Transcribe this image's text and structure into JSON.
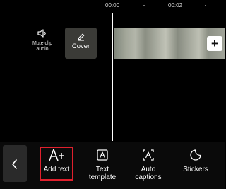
{
  "timeline": {
    "time_labels": [
      "00:00",
      "00:02"
    ]
  },
  "left_controls": {
    "mute_label": "Mute clip\naudio",
    "cover_label": "Cover"
  },
  "clip": {
    "add_clip_symbol": "+"
  },
  "toolbar": {
    "tools": [
      {
        "label": "Add text",
        "icon": "add-text-icon"
      },
      {
        "label": "Text\ntemplate",
        "icon": "text-template-icon"
      },
      {
        "label": "Auto\ncaptions",
        "icon": "auto-captions-icon"
      },
      {
        "label": "Stickers",
        "icon": "stickers-icon"
      }
    ],
    "selected_index": 0
  },
  "colors": {
    "highlight": "#e0202d",
    "background": "#000000",
    "cover_button": "#3b3b37"
  }
}
